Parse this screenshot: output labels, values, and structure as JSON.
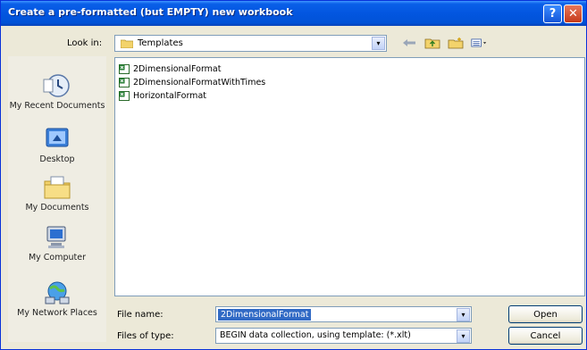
{
  "window": {
    "title": "Create a pre-formatted (but EMPTY) new workbook",
    "help_glyph": "?",
    "close_glyph": "✕"
  },
  "look_in": {
    "label": "Look in:",
    "value": "Templates"
  },
  "toolbar": {
    "arrow_glyph": "▾",
    "back_icon": "back-arrow-icon",
    "up_icon": "up-folder-icon",
    "new_folder_icon": "new-folder-icon",
    "views_icon": "views-menu-icon"
  },
  "places": [
    {
      "label": "My Recent Documents",
      "icon": "recent-documents-icon"
    },
    {
      "label": "Desktop",
      "icon": "desktop-icon"
    },
    {
      "label": "My Documents",
      "icon": "my-documents-icon"
    },
    {
      "label": "My Computer",
      "icon": "my-computer-icon"
    },
    {
      "label": "My Network Places",
      "icon": "network-places-icon"
    }
  ],
  "files": [
    {
      "name": "2DimensionalFormat"
    },
    {
      "name": "2DimensionalFormatWithTimes"
    },
    {
      "name": "HorizontalFormat"
    }
  ],
  "file_name": {
    "label": "File name:",
    "value": "2DimensionalFormat"
  },
  "file_type": {
    "label": "Files of type:",
    "value": "BEGIN data collection, using template: (*.xlt)"
  },
  "buttons": {
    "open": "Open",
    "cancel": "Cancel"
  },
  "colors": {
    "title_bar": "#0356e0",
    "selection": "#316ac5",
    "dialog_face": "#ece9d8"
  }
}
